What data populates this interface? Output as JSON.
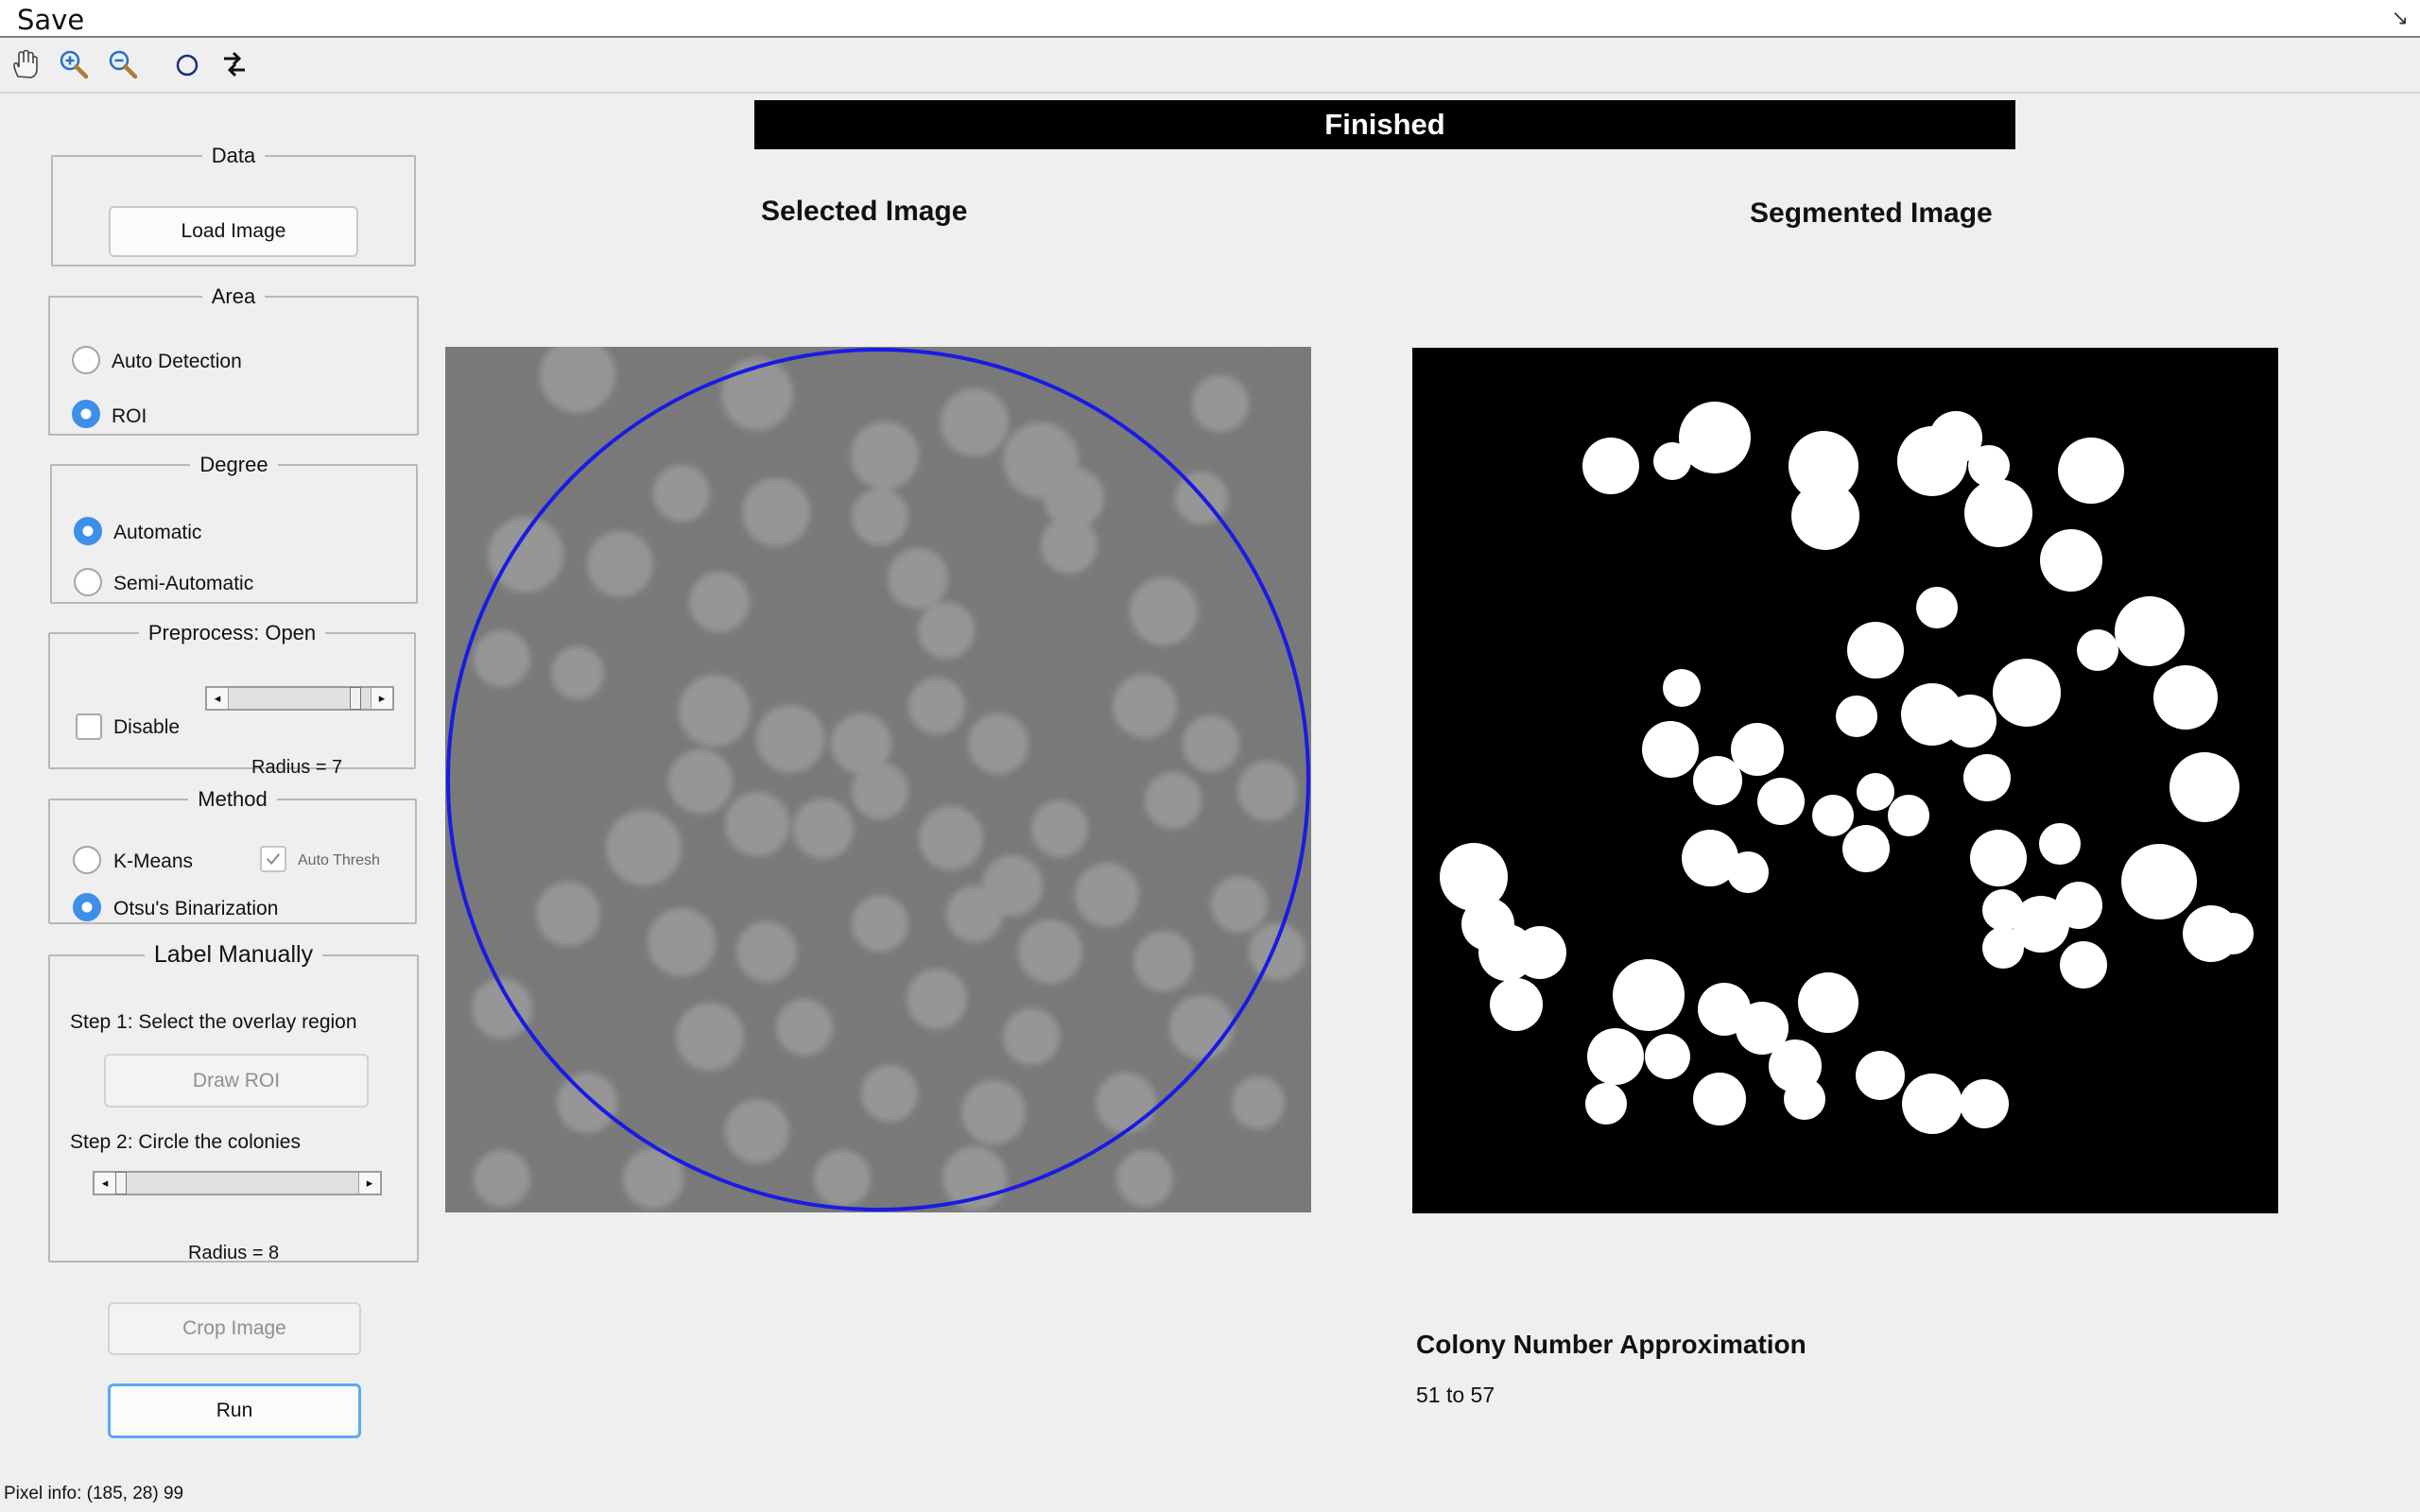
{
  "menubar": {
    "save_label": "Save",
    "resize_glyph": "↘"
  },
  "toolbar": {
    "tools": [
      {
        "name": "pan-hand-icon"
      },
      {
        "name": "zoom-in-icon"
      },
      {
        "name": "zoom-out-icon"
      },
      {
        "name": "circle-icon"
      },
      {
        "name": "swap-arrows-icon"
      }
    ]
  },
  "status": {
    "text": "Finished",
    "bg": "#000000",
    "fg": "#ffffff"
  },
  "panels": {
    "data": {
      "title": "Data",
      "load_button": "Load Image"
    },
    "area": {
      "title": "Area",
      "options": [
        "Auto Detection",
        "ROI"
      ],
      "selected": "ROI"
    },
    "degree": {
      "title": "Degree",
      "options": [
        "Automatic",
        "Semi-Automatic"
      ],
      "selected": "Automatic"
    },
    "preprocess": {
      "title": "Preprocess: Open",
      "disable_label": "Disable",
      "disable_checked": false,
      "radius_text": "Radius = 7",
      "slider_level": 0.92
    },
    "method": {
      "title": "Method",
      "options": [
        "K-Means",
        "Otsu's Binarization"
      ],
      "selected": "Otsu's Binarization",
      "auto_thresh_label": "Auto Thresh",
      "auto_thresh_checked": true
    },
    "label_manually": {
      "title": "Label Manually",
      "step1": "Step 1: Select the overlay region",
      "draw_roi": "Draw ROI",
      "step2": "Step 2: Circle the colonies",
      "radius_text": "Radius = 8",
      "slider_level": 0.0
    }
  },
  "buttons": {
    "crop": "Crop Image",
    "run": "Run"
  },
  "main": {
    "selected_title": "Selected Image",
    "segmented_title": "Segmented Image",
    "count_title": "Colony Number Approximation",
    "count_value": "51 to 57"
  },
  "footer": {
    "pixel_info": "Pixel info: (185, 28)  99"
  },
  "colors": {
    "accent": "#3d8fe8",
    "roi_circle": "#1a1ae6",
    "panel_bg": "#efefef"
  }
}
